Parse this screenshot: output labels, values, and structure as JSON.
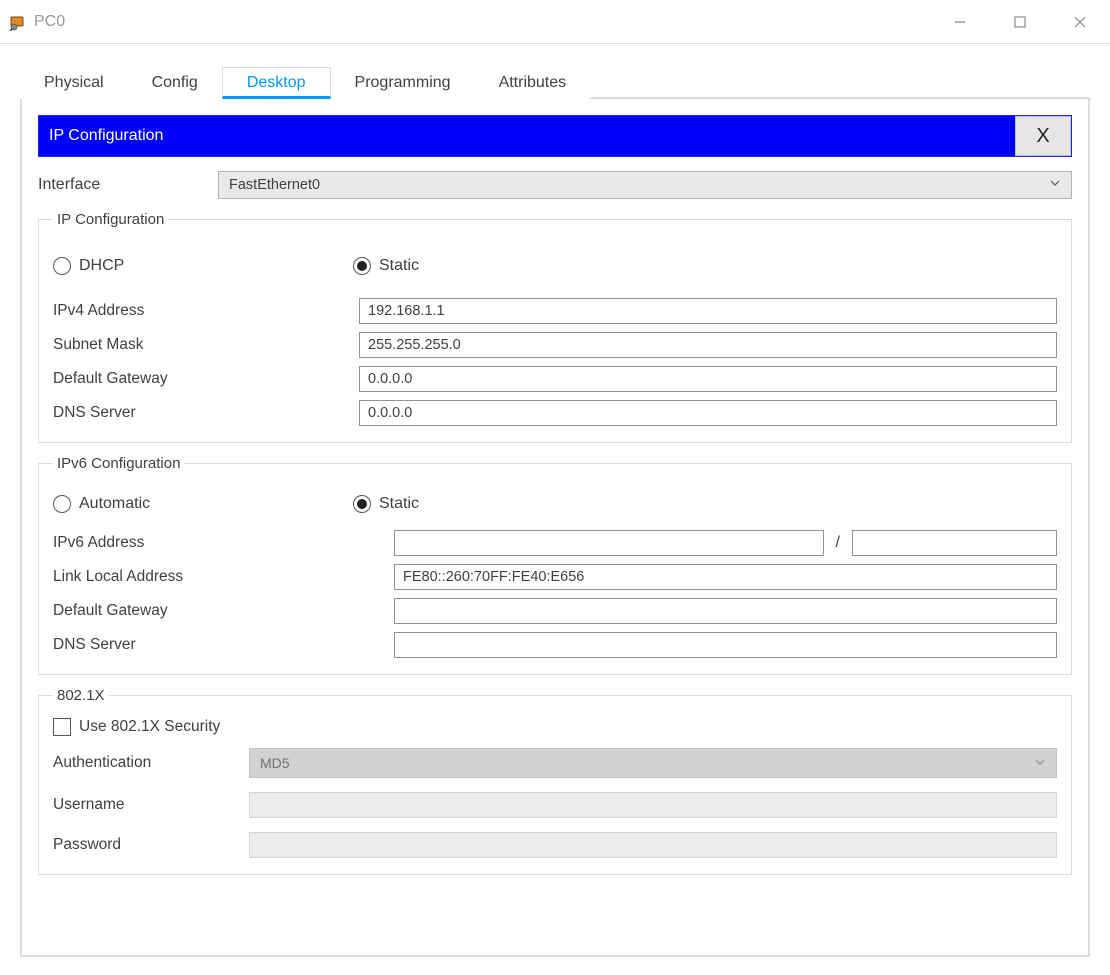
{
  "window": {
    "title": "PC0"
  },
  "tabs": {
    "physical": "Physical",
    "config": "Config",
    "desktop": "Desktop",
    "programming": "Programming",
    "attributes": "Attributes",
    "active": "desktop"
  },
  "panel": {
    "title": "IP Configuration",
    "close": "X"
  },
  "interface": {
    "label": "Interface",
    "selected": "FastEthernet0"
  },
  "ipv4": {
    "legend": "IP Configuration",
    "dhcp_label": "DHCP",
    "static_label": "Static",
    "ipv4_label": "IPv4 Address",
    "ipv4_value": "192.168.1.1",
    "subnet_label": "Subnet Mask",
    "subnet_value": "255.255.255.0",
    "gateway_label": "Default Gateway",
    "gateway_value": "0.0.0.0",
    "dns_label": "DNS Server",
    "dns_value": "0.0.0.0"
  },
  "ipv6": {
    "legend": "IPv6 Configuration",
    "auto_label": "Automatic",
    "static_label": "Static",
    "addr_label": "IPv6 Address",
    "addr_value": "",
    "prefix_value": "",
    "slash": "/",
    "linklocal_label": "Link Local Address",
    "linklocal_value": "FE80::260:70FF:FE40:E656",
    "gateway_label": "Default Gateway",
    "gateway_value": "",
    "dns_label": "DNS Server",
    "dns_value": ""
  },
  "dot1x": {
    "legend": "802.1X",
    "use_label": "Use 802.1X Security",
    "auth_label": "Authentication",
    "auth_value": "MD5",
    "user_label": "Username",
    "user_value": "",
    "pass_label": "Password",
    "pass_value": ""
  }
}
